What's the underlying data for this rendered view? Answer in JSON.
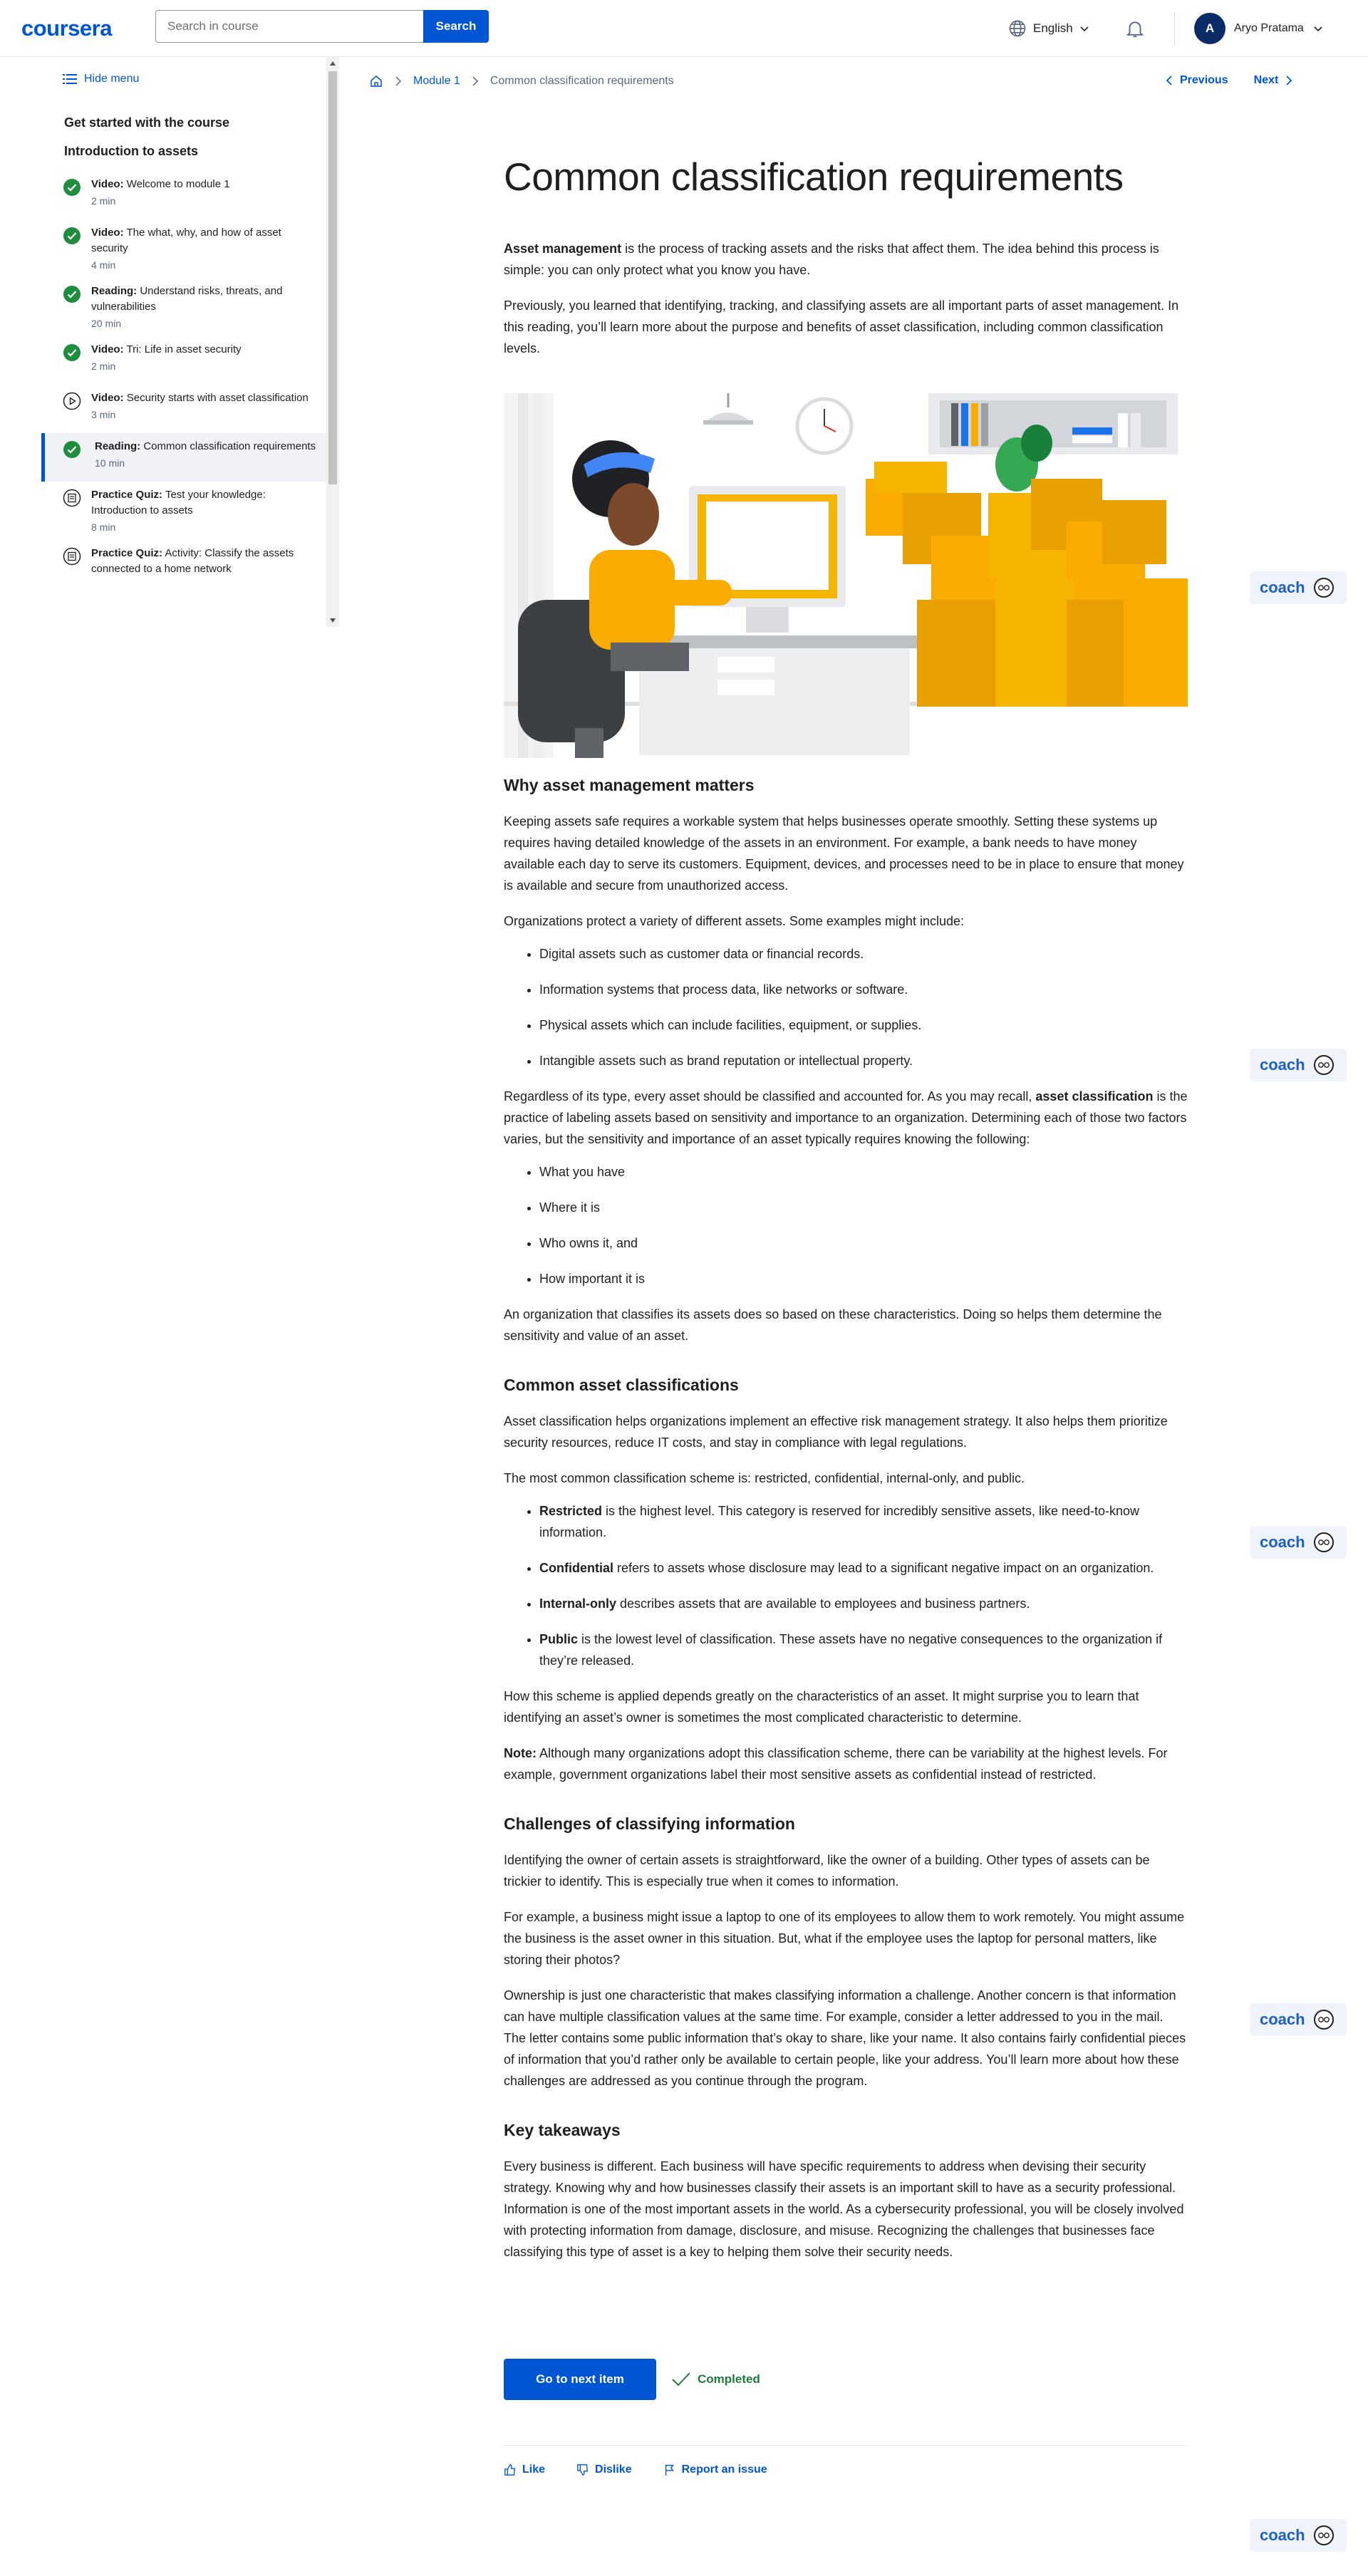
{
  "header": {
    "logo": "coursera",
    "search_placeholder": "Search in course",
    "search_button": "Search",
    "language": "English",
    "avatar_initial": "A",
    "user_name": "Aryo Pratama",
    "brand_color": "#0056d2"
  },
  "sidebar": {
    "hide_menu": "Hide menu",
    "module_heading": "Get started with the course",
    "section_heading": "Introduction to assets",
    "items": [
      {
        "type": "Video:",
        "title": "Welcome to module 1",
        "meta": "2 min",
        "status": "completed"
      },
      {
        "type": "Video:",
        "title": "The what, why, and how of asset security",
        "meta": "4 min",
        "status": "completed"
      },
      {
        "type": "Reading:",
        "title": "Understand risks, threats, and vulnerabilities",
        "meta": "20 min",
        "status": "completed"
      },
      {
        "type": "Video:",
        "title": "Tri: Life in asset security",
        "meta": "2 min",
        "status": "completed"
      },
      {
        "type": "Video:",
        "title": "Security starts with asset classification",
        "meta": "3 min",
        "status": "play"
      },
      {
        "type": "Reading:",
        "title": "Common classification requirements",
        "meta": "10 min",
        "status": "completed-active"
      },
      {
        "type": "Practice Quiz:",
        "title": "Test your knowledge: Introduction to assets",
        "meta": "8 min",
        "status": "quiz"
      },
      {
        "type": "Practice Quiz:",
        "title": "Activity: Classify the assets connected to a home network",
        "meta": "",
        "status": "quiz"
      }
    ]
  },
  "breadcrumb": {
    "module": "Module 1",
    "current": "Common classification requirements"
  },
  "nav": {
    "previous": "Previous",
    "next": "Next"
  },
  "article": {
    "title": "Common classification requirements",
    "intro_bold": "Asset management",
    "intro_rest": " is the process of tracking assets and the risks that affect them. The idea behind this process is simple: you can only protect what you know you have.",
    "intro_p2": "Previously, you learned that identifying, tracking, and classifying assets are all important parts of asset management. In this reading, you’ll learn more about the purpose and benefits of asset classification, including common classification levels.",
    "s1_heading": "Why asset management matters",
    "s1_p1": "Keeping assets safe requires a workable system that helps businesses operate smoothly. Setting these systems up requires having detailed knowledge of the assets in an environment. For example, a bank needs to have money available each day to serve its customers. Equipment, devices, and processes need to be in place to ensure that money is available and secure from unauthorized access.",
    "s1_p2": "Organizations protect a variety of different assets. Some examples might include:",
    "s1_list": [
      "Digital assets such as customer data or financial records.",
      "Information systems that process data, like networks or software.",
      "Physical assets which can include facilities, equipment, or supplies.",
      "Intangible assets such as brand reputation or intellectual property."
    ],
    "s1_p3_a": "Regardless of its type, every asset should be classified and accounted for. As you may recall, ",
    "s1_p3_bold": "asset classification",
    "s1_p3_b": " is the practice of labeling assets based on sensitivity and importance to an organization. Determining each of those two factors varies, but the sensitivity and importance of an asset typically requires knowing the following:",
    "s1_list2": [
      "What you have",
      "Where it is",
      "Who owns it, and",
      "How important it is"
    ],
    "s1_p4": "An organization that classifies its assets does so based on these characteristics. Doing so helps them determine the sensitivity and value of an asset.",
    "s2_heading": "Common asset classifications",
    "s2_p1": "Asset classification helps organizations implement an effective risk management strategy. It also helps them prioritize security resources, reduce IT costs, and stay in compliance with legal regulations.",
    "s2_p2": "The most common classification scheme is: restricted, confidential, internal-only, and public.",
    "s2_list": [
      {
        "bold": "Restricted",
        "rest": " is the highest level. This category is reserved for incredibly sensitive assets,  like need-to-know information."
      },
      {
        "bold": "Confidential",
        "rest": " refers to assets whose disclosure may lead to a significant negative impact on an organization."
      },
      {
        "bold": "Internal-only",
        "rest": " describes assets that are available to employees and business partners."
      },
      {
        "bold": "Public",
        "rest": " is the lowest level of classification. These assets have no negative consequences to the organization if they’re released."
      }
    ],
    "s2_p3": "How this scheme is applied depends greatly on the characteristics of an asset. It might surprise you to learn that identifying an asset’s owner is sometimes the most complicated characteristic to determine.",
    "s2_note_bold": "Note:",
    "s2_note_rest": " Although many organizations adopt this classification scheme, there can be variability at the highest levels. For example, government organizations label their most sensitive assets as confidential instead of restricted.",
    "s3_heading": "Challenges of classifying information",
    "s3_p1": "Identifying the owner of certain assets is straightforward, like the owner of a building. Other types of assets can be trickier to identify. This is especially true when it comes to information.",
    "s3_p2": "For example, a business might issue a laptop to one of its employees to allow them to work remotely. You might assume the business is the asset owner in this situation. But, what if the employee uses the laptop for personal matters, like storing their photos?",
    "s3_p3": "Ownership is just one characteristic that makes classifying information a challenge. Another concern is that information can have multiple classification values at the same time. For example, consider a letter addressed to you in the mail. The letter contains some public information that’s okay to share, like your name. It also contains fairly confidential pieces of information that you’d rather only be available to certain people, like your address. You’ll learn more about how these challenges are addressed as you continue through the program.",
    "s4_heading": "Key takeaways",
    "s4_p1": "Every business is different. Each business will have specific requirements to address when devising their security strategy. Knowing why and how businesses classify their assets is an important skill to have as a security professional. Information is one of the most important assets in the world. As a cybersecurity professional, you will be closely involved with protecting information from damage, disclosure, and misuse. Recognizing the challenges that businesses face classifying this type of asset is a key to helping them solve their security needs."
  },
  "footer": {
    "next_button": "Go to next item",
    "completed": "Completed",
    "like": "Like",
    "dislike": "Dislike",
    "report": "Report an issue"
  },
  "coach": {
    "label": "coach"
  }
}
